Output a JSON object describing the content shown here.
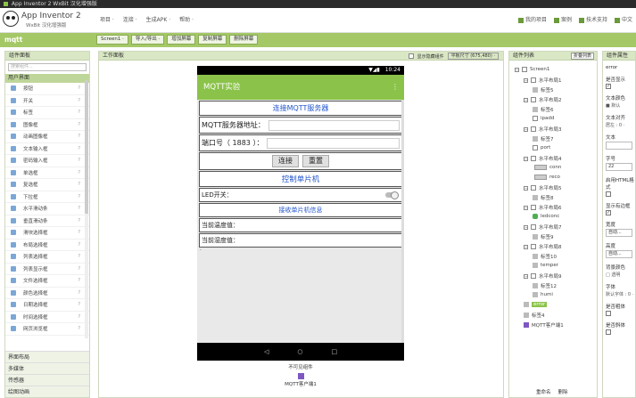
{
  "window": {
    "title": "App Inventor 2 WxBit 汉化增强版"
  },
  "header": {
    "app_name": "App Inventor 2",
    "app_sub": "WxBit 汉化增强版",
    "menu": [
      "项目 ·",
      "连接 ·",
      "生成APK ·",
      "帮助 ·"
    ],
    "right_links": [
      "我的项目",
      "案例",
      "技术支持",
      "中文"
    ]
  },
  "project": {
    "name": "mqtt",
    "buttons": [
      "Screen1 ·",
      "导入/导出 ·",
      "增加屏幕",
      "复制屏幕",
      "删除屏幕"
    ]
  },
  "palette": {
    "title": "组件面板",
    "search_placeholder": "搜索组件...",
    "category": "用户界面",
    "items": [
      "按钮",
      "开关",
      "标签",
      "图像框",
      "动画图像框",
      "文本输入框",
      "密码输入框",
      "单选框",
      "复选框",
      "下拉框",
      "水平滑动条",
      "垂直滑动条",
      "滑块选择框",
      "布局选择框",
      "列表选择框",
      "列表显示框",
      "文件选择框",
      "颜色选择框",
      "日期选择框",
      "时间选择框",
      "网页浏览框"
    ],
    "help_mark": "?",
    "other_categories": [
      "界面布局",
      "多媒体",
      "传感器",
      "绘图动画"
    ]
  },
  "viewer": {
    "title": "工作面板",
    "show_hidden": "显示隐藏组件",
    "size_select": "平板尺寸 (675,480) ·"
  },
  "phone": {
    "time": "10:24",
    "status_icons": "▼◢▮",
    "app_title": "MQTT实验",
    "menu_dots": "⋮",
    "rows": {
      "connect_header": "连接MQTT服务器",
      "server_label": "MQTT服务器地址：",
      "port_label": "端口号（ 1883 ）：",
      "connect_btn": "连接",
      "reset_btn": "重置",
      "control_header": "控制单片机",
      "led_label": "LED开关：",
      "receive_header": "接收单片机信息",
      "temp_label": "当前温度值：",
      "humid_label": "当前湿度值：",
      "empty_label": "-"
    },
    "nav": {
      "back": "◁",
      "home": "○",
      "recent": "□"
    }
  },
  "nonvisible": {
    "title": "不可见组件",
    "item": "MQTT客户端1"
  },
  "tree": {
    "title": "组件列表",
    "collapse_btn": "折叠列表",
    "nodes": [
      {
        "label": "Screen1",
        "lvl": 0,
        "kind": "box",
        "exp": "−"
      },
      {
        "label": "水平布局1",
        "lvl": 1,
        "kind": "box",
        "exp": "−"
      },
      {
        "label": "标签5",
        "lvl": 2,
        "kind": "lbl",
        "exp": ""
      },
      {
        "label": "水平布局2",
        "lvl": 1,
        "kind": "box",
        "exp": "−"
      },
      {
        "label": "标签6",
        "lvl": 2,
        "kind": "lbl",
        "exp": ""
      },
      {
        "label": "ipadd",
        "lvl": 2,
        "kind": "box",
        "exp": ""
      },
      {
        "label": "水平布局3",
        "lvl": 1,
        "kind": "box",
        "exp": "−"
      },
      {
        "label": "标签7",
        "lvl": 2,
        "kind": "lbl",
        "exp": ""
      },
      {
        "label": "port",
        "lvl": 2,
        "kind": "box",
        "exp": ""
      },
      {
        "label": "水平布局4",
        "lvl": 1,
        "kind": "box",
        "exp": "−"
      },
      {
        "label": "conn",
        "lvl": 2,
        "kind": "btn",
        "exp": ""
      },
      {
        "label": "reco",
        "lvl": 2,
        "kind": "btn",
        "exp": ""
      },
      {
        "label": "水平布局5",
        "lvl": 1,
        "kind": "box",
        "exp": "−"
      },
      {
        "label": "标签8",
        "lvl": 2,
        "kind": "lbl",
        "exp": ""
      },
      {
        "label": "水平布局6",
        "lvl": 1,
        "kind": "box",
        "exp": "−"
      },
      {
        "label": "ledconc",
        "lvl": 2,
        "kind": "sw",
        "exp": ""
      },
      {
        "label": "水平布局7",
        "lvl": 1,
        "kind": "box",
        "exp": "−"
      },
      {
        "label": "标签9",
        "lvl": 2,
        "kind": "lbl",
        "exp": ""
      },
      {
        "label": "水平布局8",
        "lvl": 1,
        "kind": "box",
        "exp": "−"
      },
      {
        "label": "标签10",
        "lvl": 2,
        "kind": "lbl",
        "exp": ""
      },
      {
        "label": "temper",
        "lvl": 2,
        "kind": "lbl",
        "exp": ""
      },
      {
        "label": "水平布局9",
        "lvl": 1,
        "kind": "box",
        "exp": "−"
      },
      {
        "label": "标签12",
        "lvl": 2,
        "kind": "lbl",
        "exp": ""
      },
      {
        "label": "humi",
        "lvl": 2,
        "kind": "lbl",
        "exp": ""
      },
      {
        "label": "error",
        "lvl": 1,
        "kind": "lbl",
        "exp": "",
        "selected": true
      },
      {
        "label": "标签4",
        "lvl": 1,
        "kind": "lbl",
        "exp": ""
      },
      {
        "label": "MQTT客户端1",
        "lvl": 1,
        "kind": "mq",
        "exp": ""
      }
    ],
    "rename_btn": "重命名",
    "delete_btn": "删除"
  },
  "props": {
    "title": "组件属性",
    "component": "error",
    "items": [
      {
        "name": "是否显示",
        "type": "cb",
        "on": true
      },
      {
        "name": "文本颜色",
        "type": "val",
        "value": "■ 默认"
      },
      {
        "name": "文本对齐",
        "type": "val",
        "value": "居左 : 0 ·"
      },
      {
        "name": "文本",
        "type": "input",
        "value": ""
      },
      {
        "name": "字号",
        "type": "input",
        "value": "22"
      },
      {
        "name": "启用HTML格式",
        "type": "cb",
        "on": false
      },
      {
        "name": "显示有边框",
        "type": "cb",
        "on": true
      },
      {
        "name": "宽度",
        "type": "input",
        "value": "自动..."
      },
      {
        "name": "高度",
        "type": "input",
        "value": "自动..."
      },
      {
        "name": "背景颜色",
        "type": "val",
        "value": "□ 透明"
      },
      {
        "name": "字体",
        "type": "val",
        "value": "默认字体 : 0 ·"
      },
      {
        "name": "是否粗体",
        "type": "cb",
        "on": false
      },
      {
        "name": "是否斜体",
        "type": "cb",
        "on": false
      }
    ]
  }
}
